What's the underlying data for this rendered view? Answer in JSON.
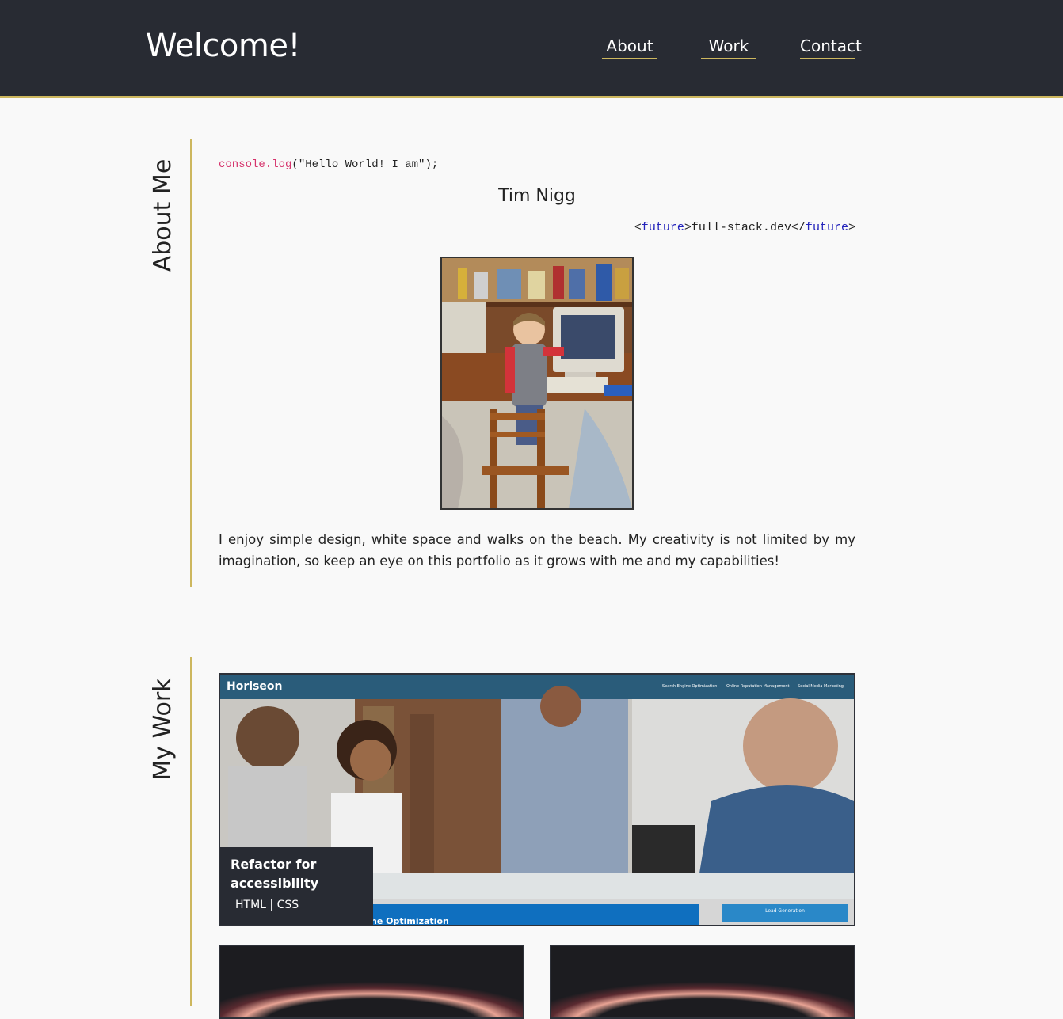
{
  "header": {
    "title": "Welcome!",
    "nav": [
      {
        "label": "About"
      },
      {
        "label": "Work"
      },
      {
        "label": "Contact"
      }
    ]
  },
  "about": {
    "heading": "About Me",
    "code_fn": "console.log",
    "code_args": "(\"Hello World! I am\");",
    "name": "Tim Nigg",
    "tag_open_bracket": "<",
    "tag_name": "future",
    "tag_close_bracket": ">",
    "tag_content": "full-stack.dev",
    "tag_end_open": "</",
    "bio": "I enjoy simple design, white space and walks on the beach. My creativity is not limited by my imagination, so keep an eye on this portfolio as it grows with me and my capabilities!"
  },
  "work": {
    "heading": "My Work",
    "featured": {
      "brand": "Horiseon",
      "nav": [
        "Search Engine Optimization",
        "Online Reputation Management",
        "Social Media Marketing"
      ],
      "banner_text": "ne Optimization",
      "button_text": "Lead Generation",
      "title": "Refactor for accessibility",
      "tech": "HTML | CSS"
    }
  },
  "colors": {
    "header_bg": "#282b33",
    "accent": "#cdb75e",
    "page_bg": "#f9f9f9"
  }
}
